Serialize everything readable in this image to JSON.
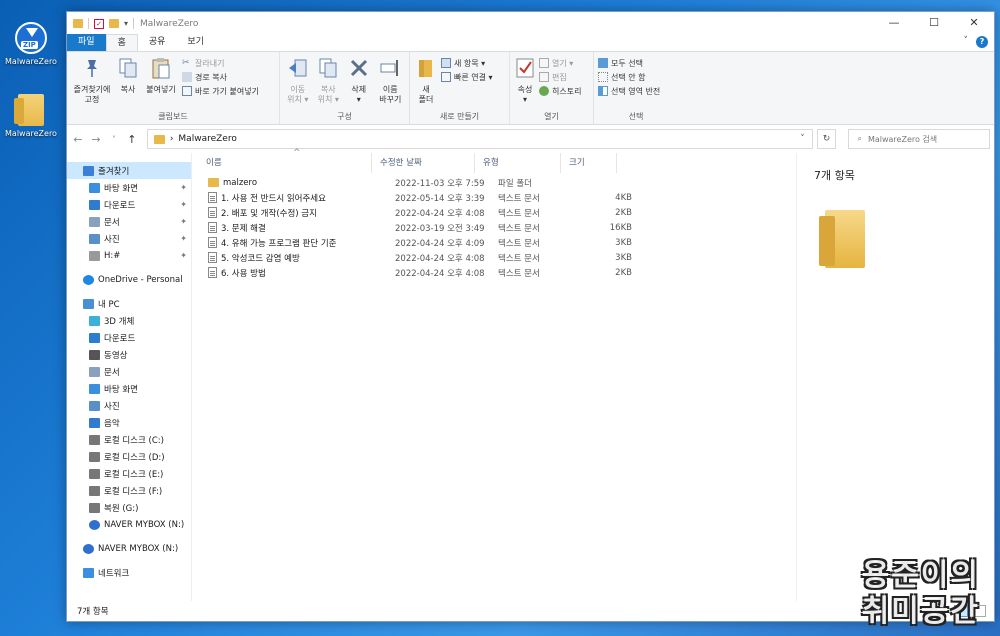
{
  "desktop": {
    "icons": [
      {
        "label": "MalwareZero",
        "type": "zip"
      },
      {
        "label": "MalwareZero",
        "type": "folder"
      }
    ]
  },
  "window": {
    "title": "MalwareZero",
    "controls": {
      "minimize": "—",
      "maximize": "☐",
      "close": "✕"
    }
  },
  "ribbon_tabs": [
    "파일",
    "홈",
    "공유",
    "보기"
  ],
  "ribbon": {
    "clipboard": {
      "pin": "즐겨찾기에\n고정",
      "copy": "복사",
      "paste": "붙여넣기",
      "cut": "잘라내기",
      "copy_path": "경로 복사",
      "paste_shortcut": "바로 가기 붙여넣기",
      "group": "클립보드"
    },
    "organize": {
      "move": "이동\n위치 ▾",
      "copyto": "복사\n위치 ▾",
      "delete": "삭제\n▾",
      "rename": "이름\n바꾸기",
      "group": "구성"
    },
    "new": {
      "new_folder": "새\n폴더",
      "new_item": "새 항목 ▾",
      "easy_access": "빠른 연결 ▾",
      "group": "새로 만들기"
    },
    "open": {
      "properties": "속성\n▾",
      "open": "열기 ▾",
      "edit": "편집",
      "history": "히스토리",
      "group": "열기"
    },
    "select": {
      "select_all": "모두 선택",
      "select_none": "선택 안 함",
      "invert": "선택 영역 반전",
      "group": "선택"
    }
  },
  "nav": {
    "back": "←",
    "forward": "→",
    "recent": "˅",
    "up": "↑",
    "address": "MalwareZero",
    "address_sep": "›",
    "dropdown": "˅",
    "refresh": "↻",
    "search_placeholder": "MalwareZero 검색"
  },
  "sidebar": [
    {
      "label": "즐겨찾기",
      "level": 0,
      "selected": true,
      "icon": "star-icon"
    },
    {
      "label": "바탕 화면",
      "level": 1,
      "pin": true,
      "icon": "desktop-icon"
    },
    {
      "label": "다운로드",
      "level": 1,
      "pin": true,
      "icon": "download-icon"
    },
    {
      "label": "문서",
      "level": 1,
      "pin": true,
      "icon": "document-icon"
    },
    {
      "label": "사진",
      "level": 1,
      "pin": true,
      "icon": "picture-icon"
    },
    {
      "label": "H:#",
      "level": 1,
      "pin": true,
      "icon": "drive-icon"
    },
    {
      "gap": true
    },
    {
      "label": "OneDrive - Personal",
      "level": 0,
      "icon": "cloud-icon"
    },
    {
      "gap": true
    },
    {
      "label": "내 PC",
      "level": 0,
      "icon": "pc-icon"
    },
    {
      "label": "3D 개체",
      "level": 1,
      "icon": "cube-icon"
    },
    {
      "label": "다운로드",
      "level": 1,
      "icon": "download-icon"
    },
    {
      "label": "동영상",
      "level": 1,
      "icon": "video-icon"
    },
    {
      "label": "문서",
      "level": 1,
      "icon": "document-icon"
    },
    {
      "label": "바탕 화면",
      "level": 1,
      "icon": "desktop-icon"
    },
    {
      "label": "사진",
      "level": 1,
      "icon": "picture-icon"
    },
    {
      "label": "음악",
      "level": 1,
      "icon": "music-icon"
    },
    {
      "label": "로컬 디스크 (C:)",
      "level": 1,
      "icon": "disk-icon"
    },
    {
      "label": "로컬 디스크 (D:)",
      "level": 1,
      "icon": "disk-icon"
    },
    {
      "label": "로컬 디스크 (E:)",
      "level": 1,
      "icon": "disk-icon"
    },
    {
      "label": "로컬 디스크 (F:)",
      "level": 1,
      "icon": "disk-icon"
    },
    {
      "label": "복원 (G:)",
      "level": 1,
      "icon": "disk-icon"
    },
    {
      "label": "NAVER MYBOX (N:)",
      "level": 1,
      "icon": "mybox-icon"
    },
    {
      "gap": true
    },
    {
      "label": "NAVER MYBOX (N:)",
      "level": 0,
      "icon": "mybox-icon"
    },
    {
      "gap": true
    },
    {
      "label": "네트워크",
      "level": 0,
      "icon": "network-icon"
    }
  ],
  "columns": [
    "이름",
    "수정한 날짜",
    "유형",
    "크기"
  ],
  "sort_indicator": "^",
  "files": [
    {
      "name": "malzero",
      "date": "2022-11-03 오후 7:59",
      "type": "파일 폴더",
      "size": "",
      "kind": "folder"
    },
    {
      "name": "1. 사용 전 반드시 읽어주세요",
      "date": "2022-05-14 오후 3:39",
      "type": "텍스트 문서",
      "size": "4KB",
      "kind": "doc"
    },
    {
      "name": "2. 배포 및 개작(수정) 금지",
      "date": "2022-04-24 오후 4:08",
      "type": "텍스트 문서",
      "size": "2KB",
      "kind": "doc"
    },
    {
      "name": "3. 문제 해결",
      "date": "2022-03-19 오전 3:49",
      "type": "텍스트 문서",
      "size": "16KB",
      "kind": "doc"
    },
    {
      "name": "4. 유해 가능 프로그램 판단 기준",
      "date": "2022-04-24 오후 4:09",
      "type": "텍스트 문서",
      "size": "3KB",
      "kind": "doc"
    },
    {
      "name": "5. 악성코드 감염 예방",
      "date": "2022-04-24 오후 4:08",
      "type": "텍스트 문서",
      "size": "3KB",
      "kind": "doc"
    },
    {
      "name": "6. 사용 방법",
      "date": "2022-04-24 오후 4:08",
      "type": "텍스트 문서",
      "size": "2KB",
      "kind": "doc"
    }
  ],
  "preview": {
    "count": "7개 항목"
  },
  "status": {
    "count": "7개 항목"
  },
  "watermark": {
    "line1": "용준이의",
    "line2": "취미공간"
  }
}
